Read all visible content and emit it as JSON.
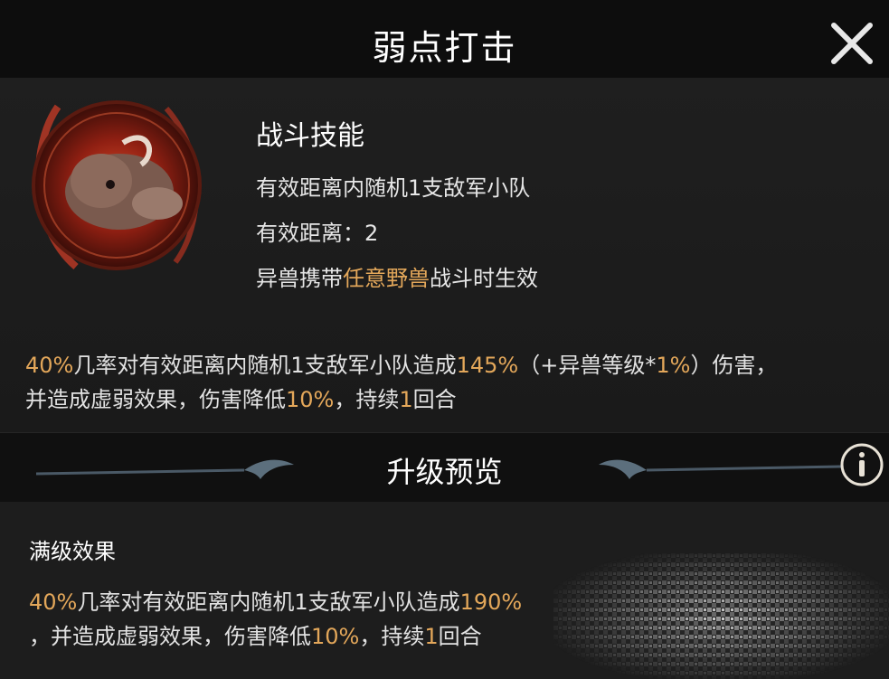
{
  "header": {
    "title": "弱点打击",
    "close_icon": "close-icon"
  },
  "skill": {
    "type": "战斗技能",
    "target": "有效距离内随机1支敌军小队",
    "range_label": "有效距离：",
    "range_value": "2",
    "condition_prefix": "异兽携带",
    "condition_highlight": "任意野兽",
    "condition_suffix": "战斗时生效"
  },
  "current_effect": {
    "p1": "40%",
    "t1": "几率对有效距离内随机1支敌军小队造成",
    "p2": "145%",
    "t2": "（+异兽等级*",
    "p3": "1%",
    "t3": "）伤害，",
    "t4": "并造成虚弱效果，伤害降低",
    "p4": "10%",
    "t5": "，持续",
    "p5": "1",
    "t6": "回合"
  },
  "upgrade": {
    "section_title": "升级预览",
    "info_icon": "info-icon",
    "max_level_label": "满级效果",
    "p1": "40%",
    "t1": "几率对有效距离内随机1支敌军小队造成",
    "p2": "190%",
    "t2": "，并造成虚弱效果，伤害降低",
    "p3": "10%",
    "t3": "，持续",
    "p4": "1",
    "t4": "回合"
  },
  "colors": {
    "highlight": "#e3a75a",
    "background": "#1b1b1b",
    "header_bg": "#0d0d0d"
  }
}
